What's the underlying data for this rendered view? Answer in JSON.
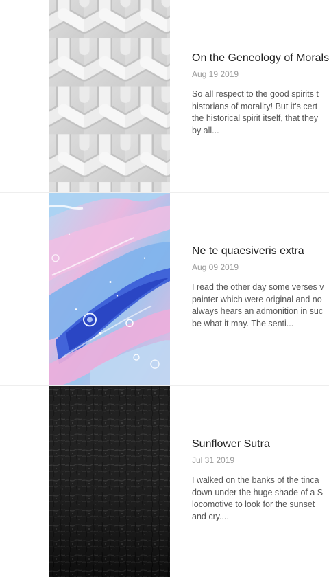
{
  "posts": [
    {
      "title": "On the Geneology of Morals",
      "date": "Aug 19 2019",
      "excerpt_lines": [
        "So all respect to the good spirits t",
        "historians of morality! But it’s cert",
        "the historical spirit itself, that they",
        "by all..."
      ],
      "image": "white-woven-pattern"
    },
    {
      "title": "Ne te quaesiveris extra",
      "date": "Aug 09 2019",
      "excerpt_lines": [
        "I read the other day some verses v",
        "painter which were original and no",
        "always hears an admonition in suc",
        "be what it may. The senti..."
      ],
      "image": "blue-pink-marble-paint"
    },
    {
      "title": "Sunflower Sutra",
      "date": "Jul 31 2019",
      "excerpt_lines": [
        "I walked on the banks of the tinca",
        "down under the huge shade of a S",
        "locomotive to look for the sunset",
        "and cry...."
      ],
      "image": "black-leather-texture"
    }
  ]
}
